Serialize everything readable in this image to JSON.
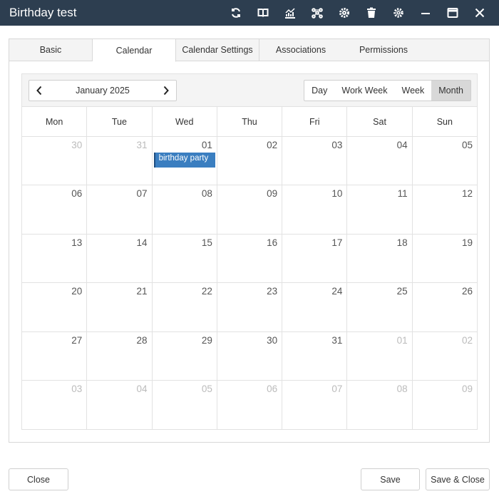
{
  "window": {
    "title": "Birthday test",
    "icons": [
      "refresh-icon",
      "book-icon",
      "chart-icon",
      "share-icon",
      "settings-gear-icon",
      "trash-icon",
      "cog-icon",
      "minimize-icon",
      "maximize-icon",
      "close-icon"
    ]
  },
  "tabs": [
    {
      "label": "Basic"
    },
    {
      "label": "Calendar"
    },
    {
      "label": "Calendar Settings"
    },
    {
      "label": "Associations"
    },
    {
      "label": "Permissions"
    }
  ],
  "activeTab": "Calendar",
  "calendar": {
    "month_label": "January 2025",
    "views": [
      "Day",
      "Work Week",
      "Week",
      "Month"
    ],
    "active_view": "Month",
    "weekdays": [
      "Mon",
      "Tue",
      "Wed",
      "Thu",
      "Fri",
      "Sat",
      "Sun"
    ],
    "weeks": [
      [
        {
          "d": "30",
          "o": true
        },
        {
          "d": "31",
          "o": true
        },
        {
          "d": "01",
          "o": false
        },
        {
          "d": "02",
          "o": false
        },
        {
          "d": "03",
          "o": false
        },
        {
          "d": "04",
          "o": false
        },
        {
          "d": "05",
          "o": false
        }
      ],
      [
        {
          "d": "06",
          "o": false
        },
        {
          "d": "07",
          "o": false
        },
        {
          "d": "08",
          "o": false
        },
        {
          "d": "09",
          "o": false
        },
        {
          "d": "10",
          "o": false
        },
        {
          "d": "11",
          "o": false
        },
        {
          "d": "12",
          "o": false
        }
      ],
      [
        {
          "d": "13",
          "o": false
        },
        {
          "d": "14",
          "o": false
        },
        {
          "d": "15",
          "o": false
        },
        {
          "d": "16",
          "o": false
        },
        {
          "d": "17",
          "o": false
        },
        {
          "d": "18",
          "o": false
        },
        {
          "d": "19",
          "o": false
        }
      ],
      [
        {
          "d": "20",
          "o": false
        },
        {
          "d": "21",
          "o": false
        },
        {
          "d": "22",
          "o": false
        },
        {
          "d": "23",
          "o": false
        },
        {
          "d": "24",
          "o": false
        },
        {
          "d": "25",
          "o": false
        },
        {
          "d": "26",
          "o": false
        }
      ],
      [
        {
          "d": "27",
          "o": false
        },
        {
          "d": "28",
          "o": false
        },
        {
          "d": "29",
          "o": false
        },
        {
          "d": "30",
          "o": false
        },
        {
          "d": "31",
          "o": false
        },
        {
          "d": "01",
          "o": true
        },
        {
          "d": "02",
          "o": true
        }
      ],
      [
        {
          "d": "03",
          "o": true
        },
        {
          "d": "04",
          "o": true
        },
        {
          "d": "05",
          "o": true
        },
        {
          "d": "06",
          "o": true
        },
        {
          "d": "07",
          "o": true
        },
        {
          "d": "08",
          "o": true
        },
        {
          "d": "09",
          "o": true
        }
      ]
    ],
    "event": {
      "title": "birthday party",
      "week": 0,
      "day": 2,
      "color": "#3a7ec0"
    }
  },
  "footer": {
    "close_label": "Close",
    "save_label": "Save",
    "save_close_label": "Save & Close"
  }
}
